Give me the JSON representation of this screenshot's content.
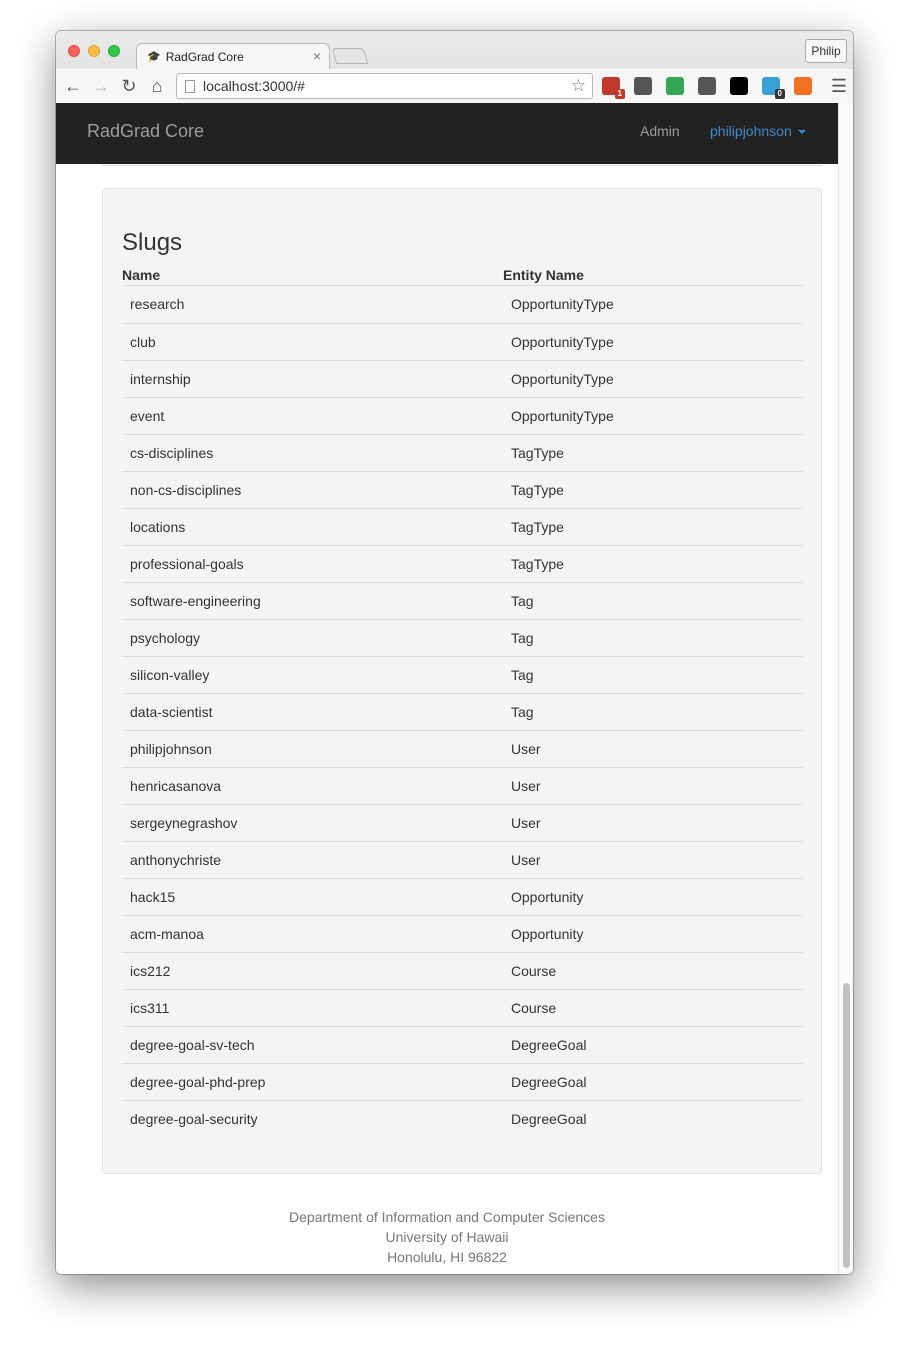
{
  "browser": {
    "tab_title": "RadGrad Core",
    "tab_close": "×",
    "profile_name": "Philip",
    "url": "localhost:3000/#",
    "extensions": [
      {
        "icon": "puzzle-extension-icon",
        "badge": "1",
        "color": "#c0392b"
      },
      {
        "icon": "sync-extension-icon",
        "badge": "",
        "color": "#555555"
      },
      {
        "icon": "hangouts-extension-icon",
        "badge": "",
        "color": "#34a853"
      },
      {
        "icon": "1password-extension-icon",
        "badge": "",
        "color": "#555555"
      },
      {
        "icon": "jetbrains-extension-icon",
        "badge": "",
        "color": "#000000"
      },
      {
        "icon": "ghostery-extension-icon",
        "badge": "0",
        "color": "#3aa0d8"
      },
      {
        "icon": "analytics-extension-icon",
        "badge": "",
        "color": "#f37021"
      }
    ]
  },
  "navbar": {
    "brand": "RadGrad Core",
    "admin_link": "Admin",
    "user_menu": "philipjohnson"
  },
  "panel": {
    "title": "Slugs",
    "columns": [
      "Name",
      "Entity Name"
    ],
    "rows": [
      {
        "name": "research",
        "entity": "OpportunityType"
      },
      {
        "name": "club",
        "entity": "OpportunityType"
      },
      {
        "name": "internship",
        "entity": "OpportunityType"
      },
      {
        "name": "event",
        "entity": "OpportunityType"
      },
      {
        "name": "cs-disciplines",
        "entity": "TagType"
      },
      {
        "name": "non-cs-disciplines",
        "entity": "TagType"
      },
      {
        "name": "locations",
        "entity": "TagType"
      },
      {
        "name": "professional-goals",
        "entity": "TagType"
      },
      {
        "name": "software-engineering",
        "entity": "Tag"
      },
      {
        "name": "psychology",
        "entity": "Tag"
      },
      {
        "name": "silicon-valley",
        "entity": "Tag"
      },
      {
        "name": "data-scientist",
        "entity": "Tag"
      },
      {
        "name": "philipjohnson",
        "entity": "User"
      },
      {
        "name": "henricasanova",
        "entity": "User"
      },
      {
        "name": "sergeynegrashov",
        "entity": "User"
      },
      {
        "name": "anthonychriste",
        "entity": "User"
      },
      {
        "name": "hack15",
        "entity": "Opportunity"
      },
      {
        "name": "acm-manoa",
        "entity": "Opportunity"
      },
      {
        "name": "ics212",
        "entity": "Course"
      },
      {
        "name": "ics311",
        "entity": "Course"
      },
      {
        "name": "degree-goal-sv-tech",
        "entity": "DegreeGoal"
      },
      {
        "name": "degree-goal-phd-prep",
        "entity": "DegreeGoal"
      },
      {
        "name": "degree-goal-security",
        "entity": "DegreeGoal"
      }
    ]
  },
  "footer": {
    "line1": "Department of Information and Computer Sciences",
    "line2": "University of Hawaii",
    "line3": "Honolulu, HI 96822"
  }
}
